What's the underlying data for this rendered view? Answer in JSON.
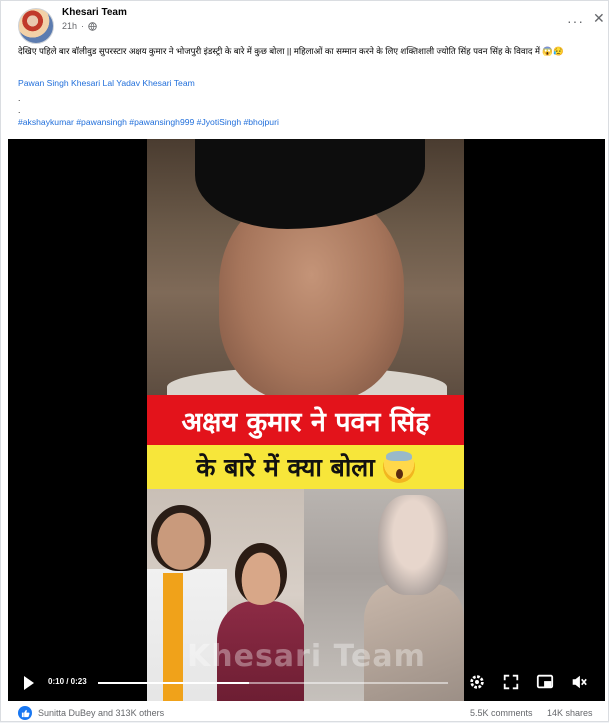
{
  "post": {
    "author": "Khesari Team",
    "time": "21h",
    "more_label": "···",
    "close_label": "✕",
    "caption": "देखिए पहिले बार बॉलीवुड सुपरस्टार अक्षय कुमार ने भोजपुरी इंडस्ट्री के बारे में कुछ बोला || महिलाओं का सम्मान करने के लिए शक्तिशाली ज्योति सिंह पवन सिंह के विवाद में 😱😥",
    "mentions": "Pawan Singh Khesari Lal Yadav Khesari Team",
    "dot1": ".",
    "dot2": ".",
    "hashtags": "#akshaykumar #pawansingh #pawansingh999 #JyotiSingh #bhojpuri"
  },
  "video": {
    "banner_line1": "अक्षय कुमार ने पवन सिंह",
    "banner_line2": "के बारे में क्या बोला",
    "watermark": "Khesari Team",
    "time": "0:10 / 0:23",
    "progress_fraction": 0.43
  },
  "footer": {
    "reactors": "Sunitta DuBey and 313K others",
    "comments": "5.5K comments",
    "shares": "14K shares"
  },
  "colors": {
    "link": "#216fdb",
    "like_blue": "#1877f2",
    "banner_red": "#e3131b",
    "banner_yellow": "#f7e63a"
  }
}
